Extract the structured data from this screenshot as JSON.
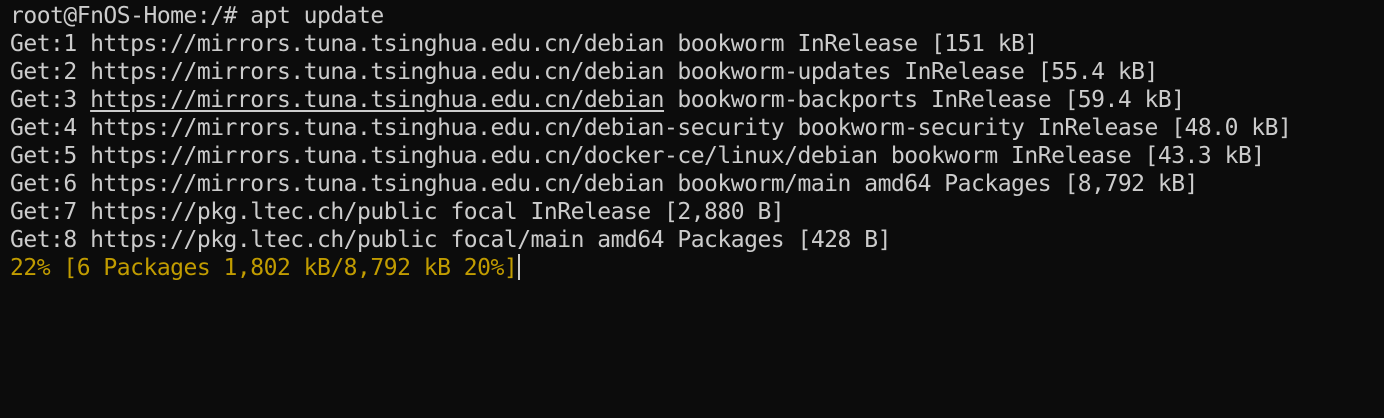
{
  "terminal": {
    "prompt": "root@FnOS-Home:/# apt update",
    "lines": [
      "Get:1 https://mirrors.tuna.tsinghua.edu.cn/debian bookworm InRelease [151 kB]",
      "Get:2 https://mirrors.tuna.tsinghua.edu.cn/debian bookworm-updates InRelease [55.4 kB]",
      "Get:4 https://mirrors.tuna.tsinghua.edu.cn/debian-security bookworm-security InRelease [48.0 kB]",
      "Get:5 https://mirrors.tuna.tsinghua.edu.cn/docker-ce/linux/debian bookworm InRelease [43.3 kB]",
      "Get:6 https://mirrors.tuna.tsinghua.edu.cn/debian bookworm/main amd64 Packages [8,792 kB]",
      "Get:7 https://pkg.ltec.ch/public focal InRelease [2,880 B]",
      "Get:8 https://pkg.ltec.ch/public focal/main amd64 Packages [428 B]"
    ],
    "line3": {
      "prefix": "Get:3 ",
      "link": "https://mirrors.tuna.tsinghua.edu.cn/debian",
      "suffix": " bookworm-backports InRelease [59.4 kB]"
    },
    "progress": "22% [6 Packages 1,802 kB/8,792 kB 20%]",
    "colors": {
      "background": "#0c0c0c",
      "foreground": "#cccccc",
      "progress": "#c19c00"
    }
  }
}
